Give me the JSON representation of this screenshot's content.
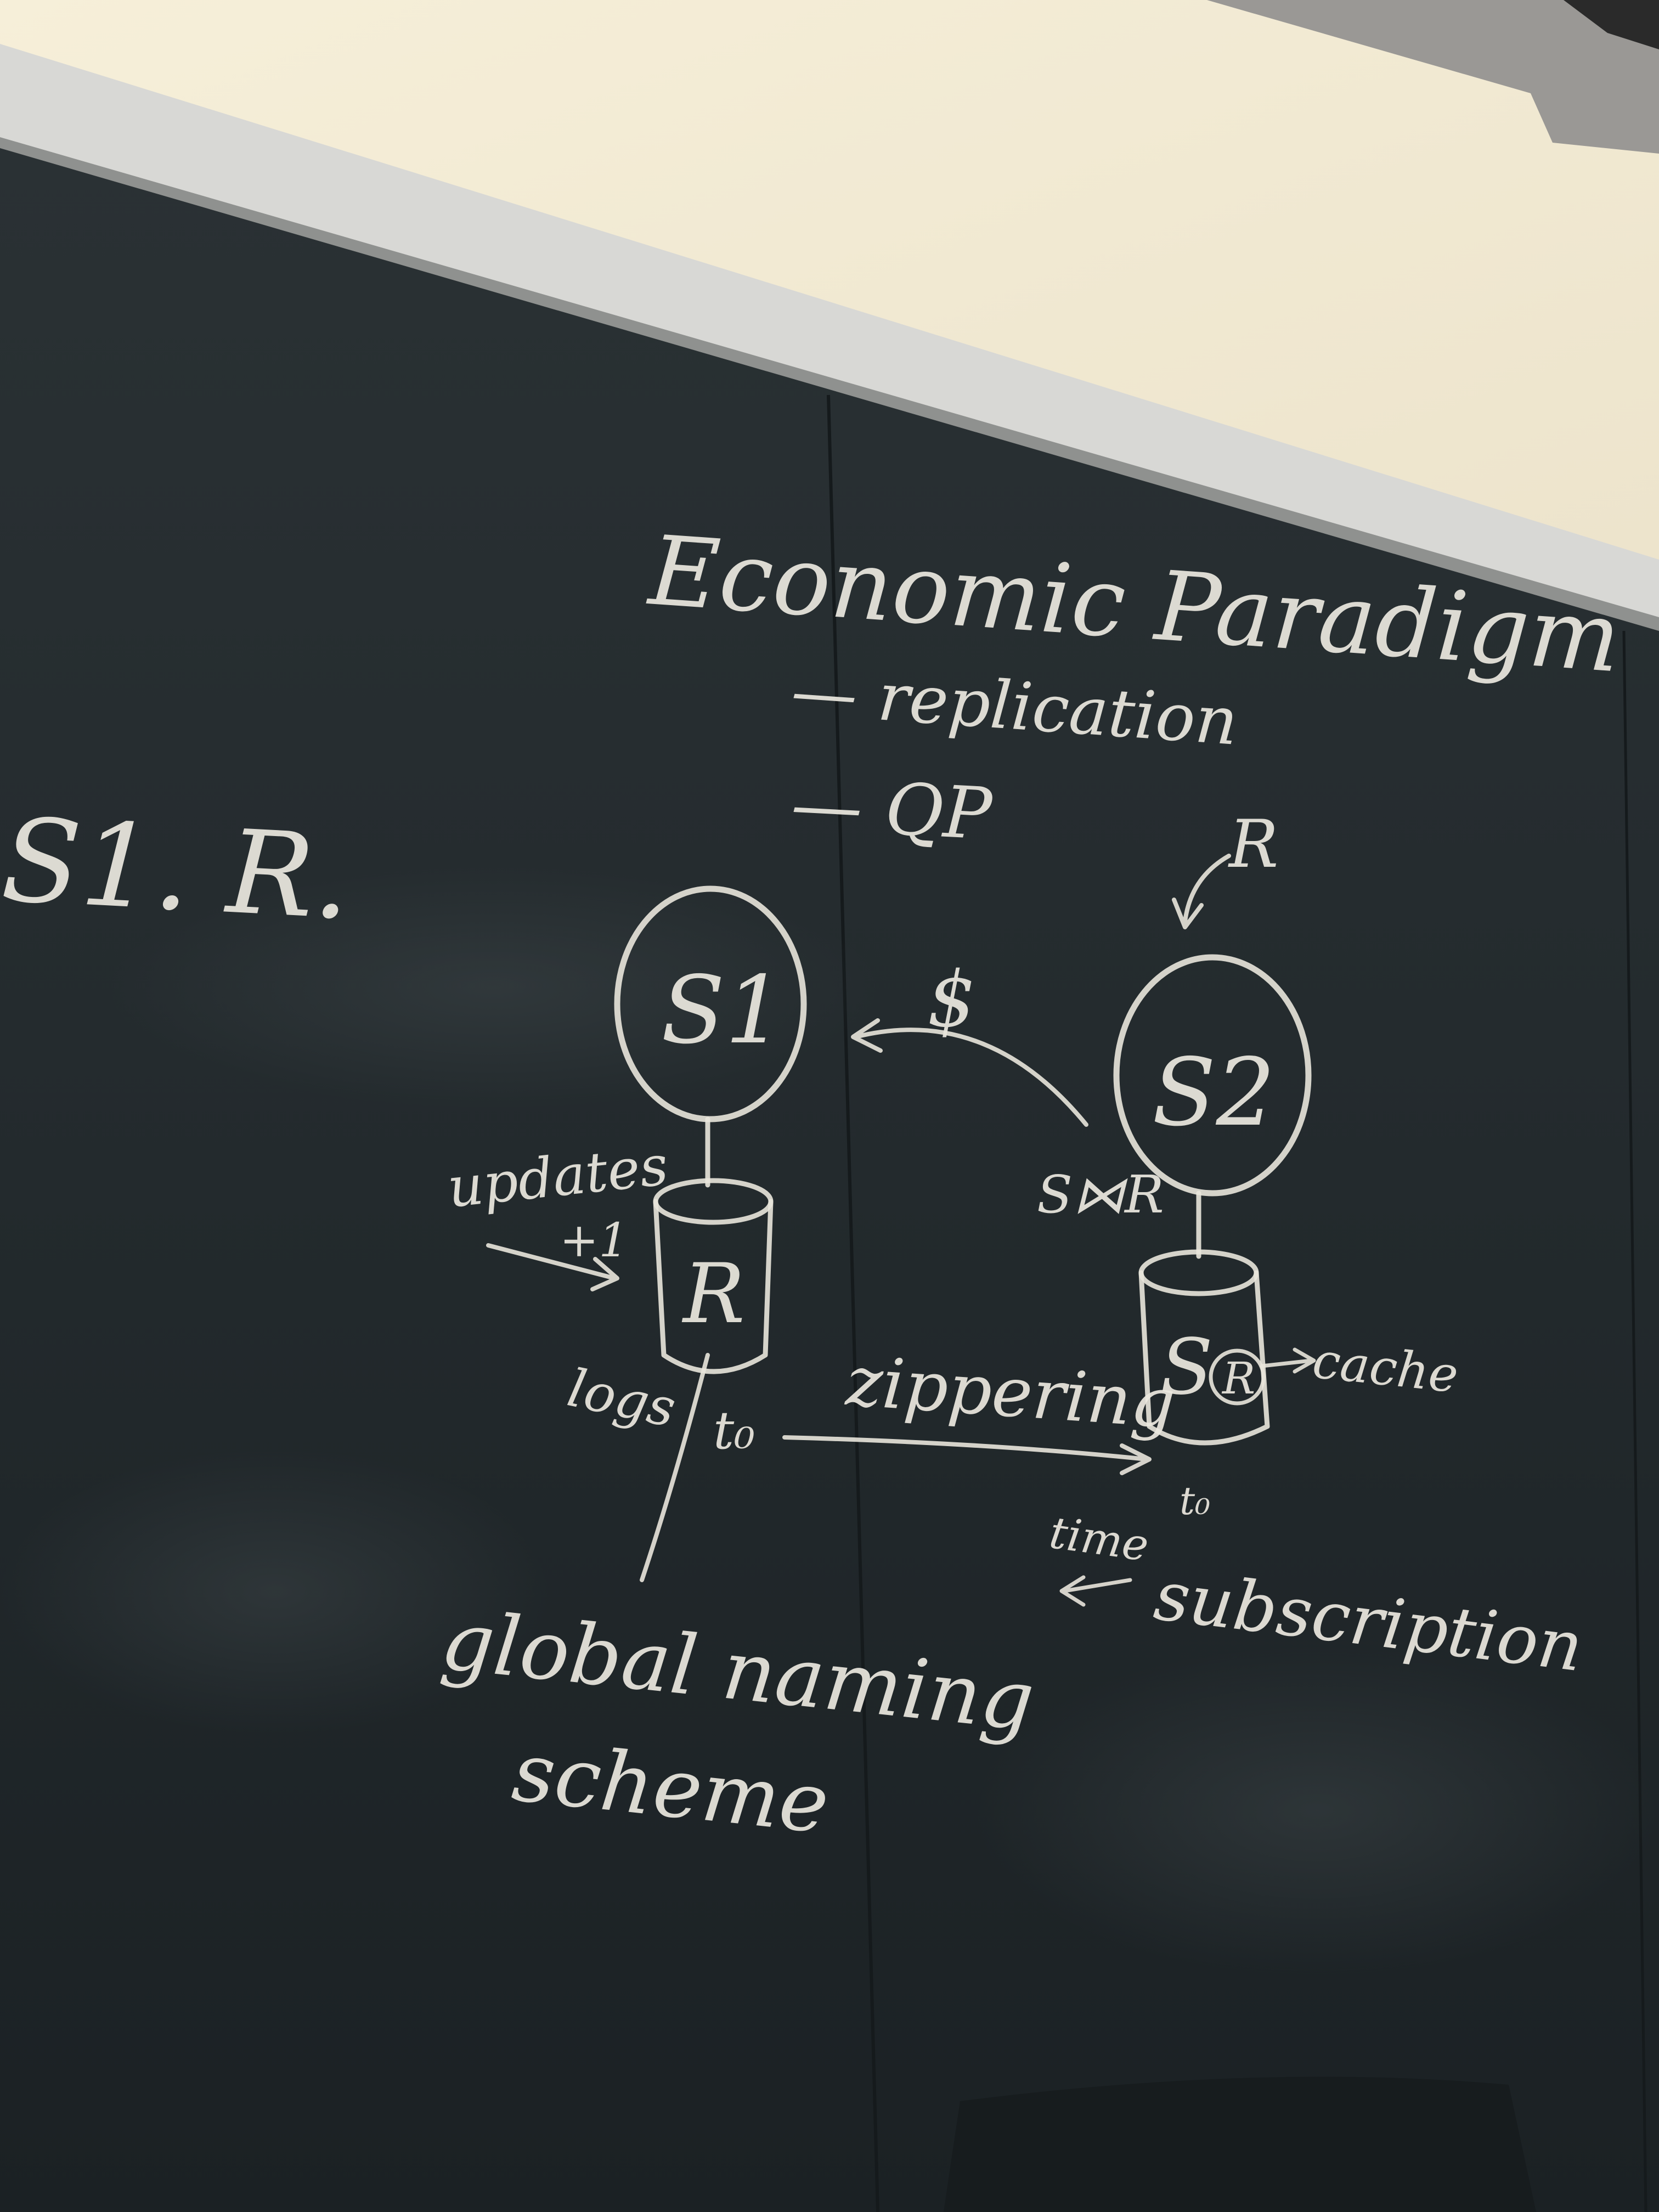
{
  "board": {
    "title": "Economic Paradigm",
    "bullets": [
      "— replication",
      "— QP"
    ],
    "left_note": "S1. R.",
    "node_s1": "S1",
    "node_s2": "S2",
    "db_r": "R",
    "db_s": "S",
    "db_s_inner": "R",
    "above_s2": "R",
    "dollar": "$",
    "join_label": "S⋈R",
    "updates": "updates",
    "plus_one": "+1",
    "logs": "logs",
    "t0": "t₀",
    "t0_small": "t₀",
    "zippering": "zippering",
    "cache": "cache",
    "time": "time",
    "subscription": "subscription",
    "global_line1": "global naming",
    "global_line2": "scheme"
  },
  "colors": {
    "chalk": "#ece9e0",
    "board": "#1f2629",
    "wall": "#f1ead6",
    "trim": "#d9d9d6"
  }
}
